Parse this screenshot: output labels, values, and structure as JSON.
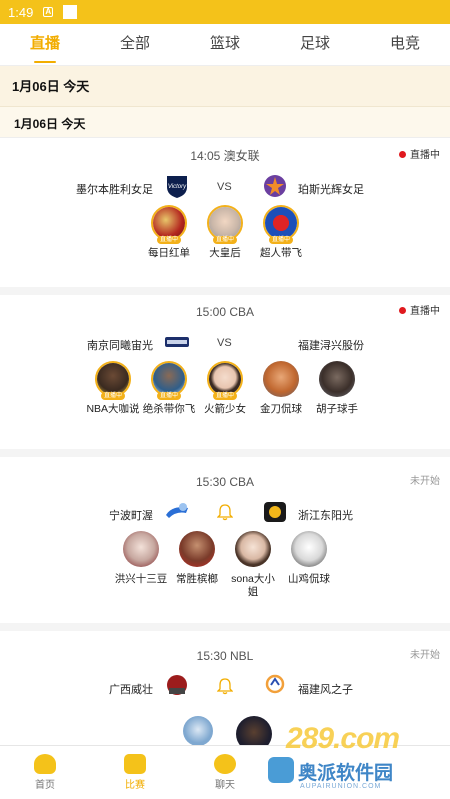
{
  "status_bar": {
    "time": "1:49",
    "icon_a": "A"
  },
  "tabs": [
    {
      "label": "直播",
      "active": true
    },
    {
      "label": "全部",
      "active": false
    },
    {
      "label": "篮球",
      "active": false
    },
    {
      "label": "足球",
      "active": false
    },
    {
      "label": "电竞",
      "active": false
    }
  ],
  "date_header": "1月06日  今天",
  "date_subheader": "1月06日    今天",
  "matches": [
    {
      "time_league": "14:05 澳女联",
      "status": "直播中",
      "home": "墨尔本胜利女足",
      "away": "珀斯光辉女足",
      "middle": "VS",
      "anchors": [
        {
          "name": "每日红单",
          "live": true,
          "live_label": "直播中"
        },
        {
          "name": "大皇后",
          "live": true,
          "live_label": "直播中"
        },
        {
          "name": "超人带飞",
          "live": true,
          "live_label": "直播中"
        }
      ]
    },
    {
      "time_league": "15:00 CBA",
      "status": "直播中",
      "home": "南京同曦宙光",
      "away": "福建浔兴股份",
      "middle": "VS",
      "anchors": [
        {
          "name": "NBA大咖说",
          "live": true,
          "live_label": "直播中"
        },
        {
          "name": "绝杀带你飞",
          "live": true,
          "live_label": "直播中"
        },
        {
          "name": "火箭少女",
          "live": true,
          "live_label": "直播中"
        },
        {
          "name": "金刀侃球",
          "live": false
        },
        {
          "name": "胡子球手",
          "live": false
        }
      ]
    },
    {
      "time_league": "15:30 CBA",
      "status": "未开始",
      "home": "宁波町渥",
      "away": "浙江东阳光",
      "middle": "bell",
      "anchors": [
        {
          "name": "洪兴十三豆",
          "live": false
        },
        {
          "name": "常胜槟榔",
          "live": false
        },
        {
          "name": "sona大小姐",
          "live": false
        },
        {
          "name": "山鸡侃球",
          "live": false
        }
      ]
    },
    {
      "time_league": "15:30 NBL",
      "status": "未开始",
      "home": "广西威壮",
      "away": "福建风之子",
      "middle": "bell"
    }
  ],
  "bottom_nav": [
    {
      "label": "首页",
      "active": false
    },
    {
      "label": "比赛",
      "active": true
    },
    {
      "label": "聊天",
      "active": false
    }
  ],
  "watermark": {
    "brand": "289.com",
    "site_cn": "奥派软件园",
    "site_en": "AUPAIRUNION.COM"
  },
  "colors": {
    "accent": "#f2ad00",
    "status_bar": "#f4c21a",
    "live_dot": "#e0191e"
  }
}
